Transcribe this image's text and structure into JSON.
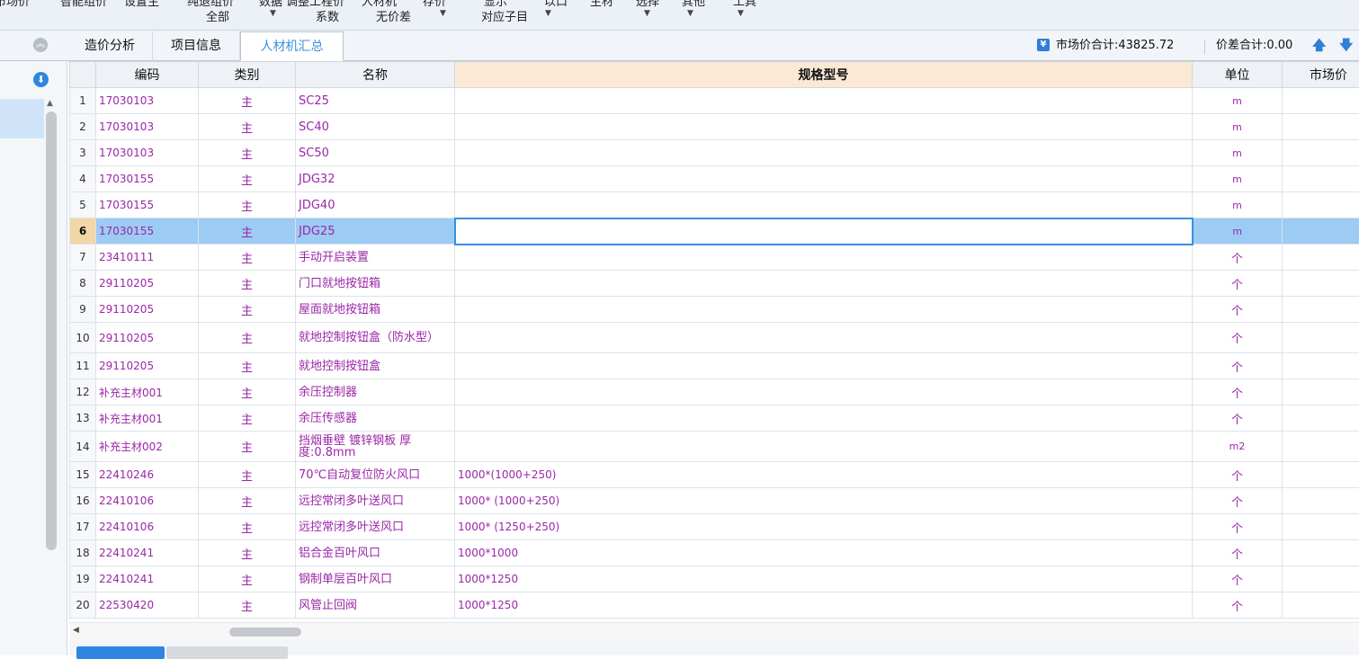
{
  "toolbar": {
    "clip_texts": [
      "市场价",
      "智能组价",
      "设置主",
      "纯退组价",
      "数据",
      "调整工程价",
      "人材机",
      "存价",
      "显示",
      "以口",
      "主材",
      "选择",
      "其他",
      "工具"
    ],
    "dropdowns": {
      "all": "全部",
      "coef": "系数",
      "no_diff": "无价差",
      "sub_item": "对应子目"
    }
  },
  "tabs": {
    "cost_analysis": "造价分析",
    "project_info": "项目信息",
    "materials_summary": "人材机汇总"
  },
  "summary": {
    "market_total": "市场价合计:43825.72",
    "price_diff_total": "价差合计:0.00"
  },
  "table": {
    "headers": {
      "code": "编码",
      "type": "类别",
      "name": "名称",
      "spec": "规格型号",
      "unit": "单位",
      "market_price": "市场价"
    },
    "rows": [
      {
        "n": "1",
        "code": "17030103",
        "type": "主",
        "name": "SC25",
        "spec": "",
        "unit": "m"
      },
      {
        "n": "2",
        "code": "17030103",
        "type": "主",
        "name": "SC40",
        "spec": "",
        "unit": "m"
      },
      {
        "n": "3",
        "code": "17030103",
        "type": "主",
        "name": "SC50",
        "spec": "",
        "unit": "m"
      },
      {
        "n": "4",
        "code": "17030155",
        "type": "主",
        "name": "JDG32",
        "spec": "",
        "unit": "m"
      },
      {
        "n": "5",
        "code": "17030155",
        "type": "主",
        "name": "JDG40",
        "spec": "",
        "unit": "m"
      },
      {
        "n": "6",
        "code": "17030155",
        "type": "主",
        "name": "JDG25",
        "spec": "",
        "unit": "m"
      },
      {
        "n": "7",
        "code": "23410111",
        "type": "主",
        "name": "手动开启装置",
        "spec": "",
        "unit": "个"
      },
      {
        "n": "8",
        "code": "29110205",
        "type": "主",
        "name": "门口就地按钮箱",
        "spec": "",
        "unit": "个"
      },
      {
        "n": "9",
        "code": "29110205",
        "type": "主",
        "name": "屋面就地按钮箱",
        "spec": "",
        "unit": "个"
      },
      {
        "n": "10",
        "code": "29110205",
        "type": "主",
        "name": "就地控制按钮盒（防水型）",
        "spec": "",
        "unit": "个"
      },
      {
        "n": "11",
        "code": "29110205",
        "type": "主",
        "name": "就地控制按钮盒",
        "spec": "",
        "unit": "个"
      },
      {
        "n": "12",
        "code": "补充主材001",
        "type": "主",
        "name": "余压控制器",
        "spec": "",
        "unit": "个"
      },
      {
        "n": "13",
        "code": "补充主材001",
        "type": "主",
        "name": "余压传感器",
        "spec": "",
        "unit": "个"
      },
      {
        "n": "14",
        "code": "补充主材002",
        "type": "主",
        "name": "挡烟垂壁 镀锌钢板 厚度:0.8mm",
        "spec": "",
        "unit": "m2"
      },
      {
        "n": "15",
        "code": "22410246",
        "type": "主",
        "name": "70℃自动复位防火风口",
        "spec": "1000*(1000+250)",
        "unit": "个"
      },
      {
        "n": "16",
        "code": "22410106",
        "type": "主",
        "name": "远控常闭多叶送风口",
        "spec": "1000* (1000+250)",
        "unit": "个"
      },
      {
        "n": "17",
        "code": "22410106",
        "type": "主",
        "name": "远控常闭多叶送风口",
        "spec": "1000* (1250+250)",
        "unit": "个"
      },
      {
        "n": "18",
        "code": "22410241",
        "type": "主",
        "name": "铝合金百叶风口",
        "spec": "1000*1000",
        "unit": "个"
      },
      {
        "n": "19",
        "code": "22410241",
        "type": "主",
        "name": "钢制单层百叶风口",
        "spec": "1000*1250",
        "unit": "个"
      },
      {
        "n": "20",
        "code": "22530420",
        "type": "主",
        "name": "风管止回阀",
        "spec": "1000*1250",
        "unit": "个"
      }
    ]
  },
  "icons": {
    "collapse": "chevron-up-icon",
    "expand": "circle-down-icon",
    "currency": "yen-icon",
    "sort_up": "arrow-up-icon",
    "sort_down": "arrow-down-icon"
  },
  "colors": {
    "accent": "#2f86e0",
    "material_text": "#9b27a8",
    "selected_row": "#9ccbf4",
    "spec_header": "#fbe9d4"
  }
}
